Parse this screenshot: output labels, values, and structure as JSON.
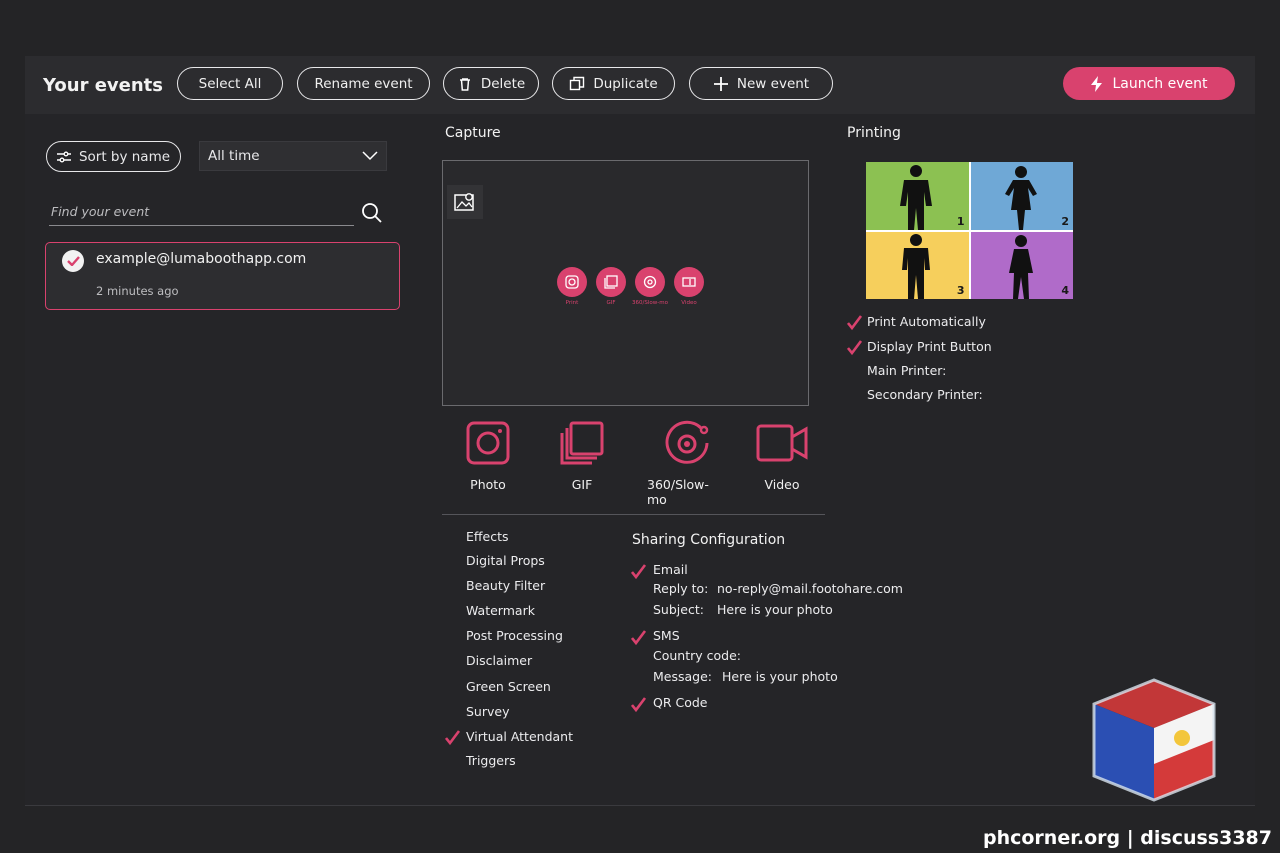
{
  "toolbar": {
    "title": "Your events",
    "select_all": "Select All",
    "rename": "Rename event",
    "delete": "Delete",
    "duplicate": "Duplicate",
    "new_event": "New event",
    "launch": "Launch event"
  },
  "sidebar": {
    "sort_label": "Sort by name",
    "time_filter": "All time",
    "search_placeholder": "Find your event",
    "events": [
      {
        "name": "example@lumaboothapp.com",
        "time": "2 minutes ago"
      }
    ]
  },
  "capture": {
    "heading": "Capture",
    "mini_modes": [
      "Print",
      "GIF",
      "360/Slow-mo",
      "Video"
    ],
    "modes": [
      {
        "label": "Photo",
        "icon": "camera-icon"
      },
      {
        "label": "GIF",
        "icon": "gif-stack-icon"
      },
      {
        "label": "360/Slow-mo",
        "icon": "spin-icon"
      },
      {
        "label": "Video",
        "icon": "video-icon"
      }
    ],
    "features": [
      {
        "label": "Effects",
        "checked": false
      },
      {
        "label": "Digital Props",
        "checked": false
      },
      {
        "label": "Beauty Filter",
        "checked": false
      },
      {
        "label": "Watermark",
        "checked": false
      },
      {
        "label": "Post Processing",
        "checked": false
      },
      {
        "label": "Disclaimer",
        "checked": false
      },
      {
        "label": "Green Screen",
        "checked": false
      },
      {
        "label": "Survey",
        "checked": false
      },
      {
        "label": "Virtual Attendant",
        "checked": true
      },
      {
        "label": "Triggers",
        "checked": false
      }
    ]
  },
  "sharing": {
    "heading": "Sharing Configuration",
    "email": {
      "label": "Email",
      "reply_to_key": "Reply to:",
      "reply_to_val": "no-reply@mail.footohare.com",
      "subject_key": "Subject:",
      "subject_val": "Here is your photo"
    },
    "sms": {
      "label": "SMS",
      "country_key": "Country code:",
      "message_key": "Message:",
      "message_val": "Here is your photo"
    },
    "qr": {
      "label": "QR Code"
    }
  },
  "printing": {
    "heading": "Printing",
    "cells": [
      {
        "num": "1",
        "color": "#8cc152"
      },
      {
        "num": "2",
        "color": "#6fa8d6"
      },
      {
        "num": "3",
        "color": "#f6cf5c"
      },
      {
        "num": "4",
        "color": "#b06bc9"
      }
    ],
    "options": [
      {
        "label": "Print Automatically",
        "checked": true
      },
      {
        "label": "Display Print Button",
        "checked": true
      },
      {
        "label": "Main Printer:",
        "checked": false
      },
      {
        "label": "Secondary Printer:",
        "checked": false
      }
    ]
  },
  "footer": {
    "watermark": "phcorner.org | discuss3387"
  },
  "colors": {
    "accent": "#d9426e",
    "background": "#242426"
  }
}
